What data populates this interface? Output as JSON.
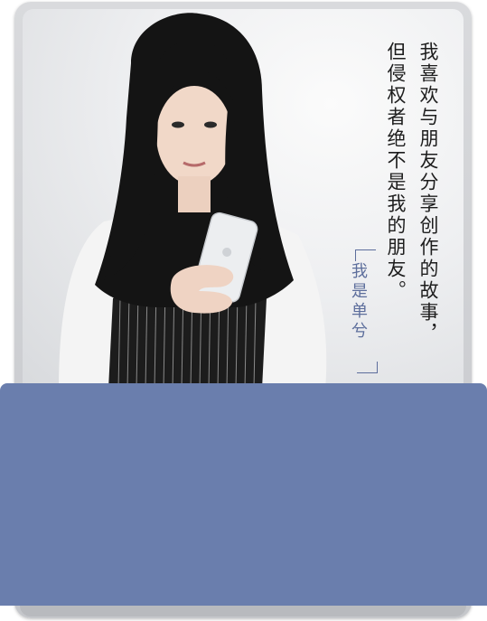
{
  "poem": {
    "line1": "我喜欢与朋友分享创作的故事，",
    "line2": "但侵权者绝不是我的朋友。",
    "signature": "我是单兮"
  },
  "colors": {
    "panel": "#6a7ead",
    "frame": "#d0d2d5",
    "signature": "#5d6e9c"
  }
}
